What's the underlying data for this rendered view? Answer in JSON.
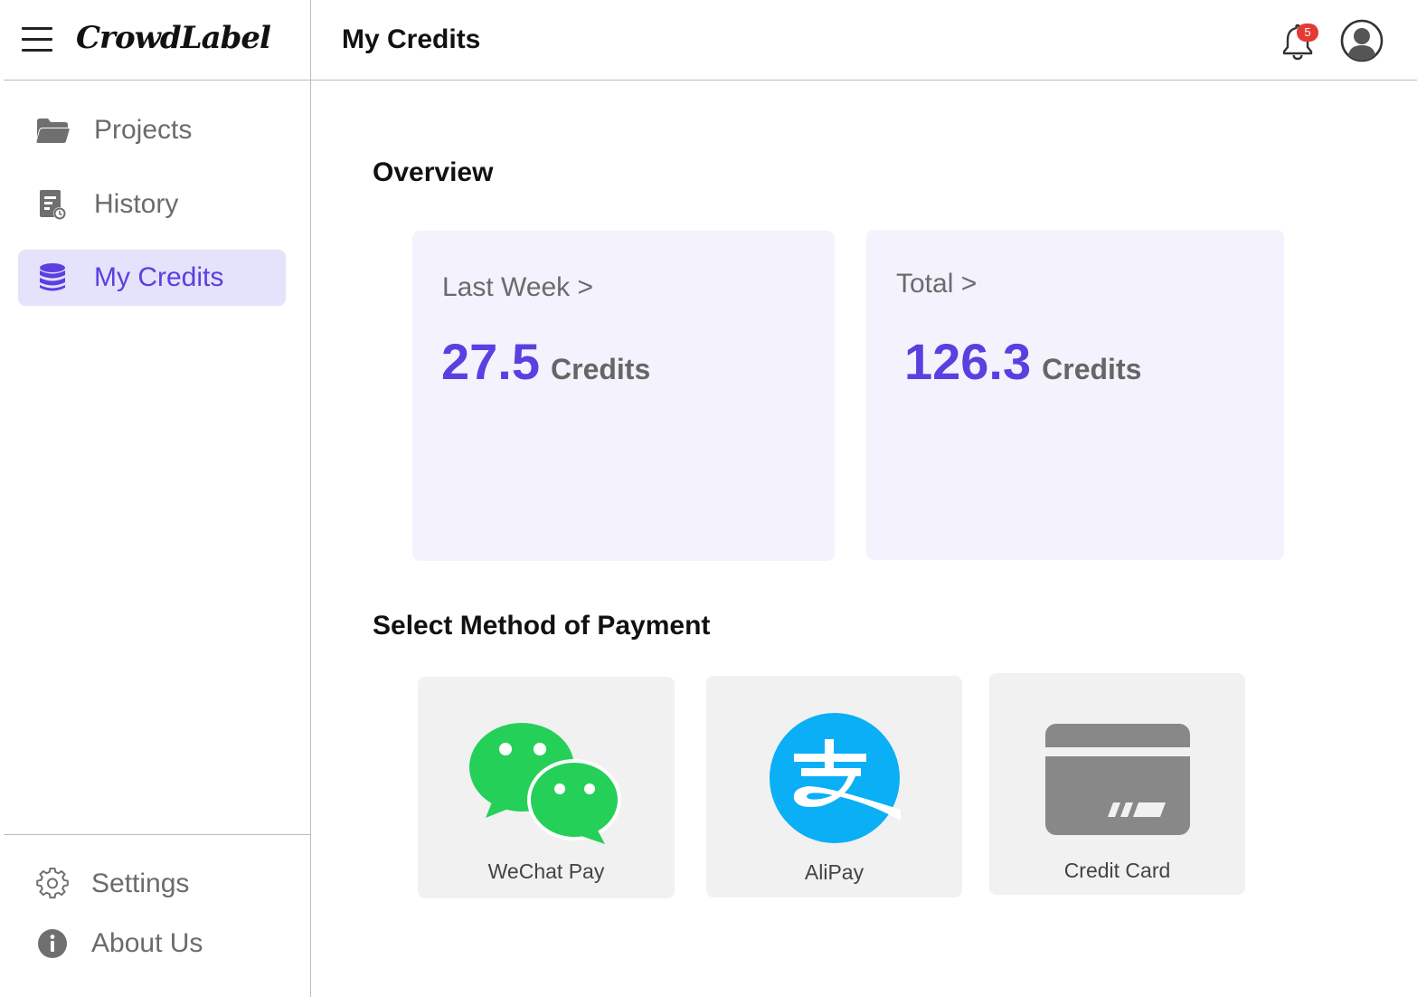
{
  "app": {
    "name": "CrowdLabel"
  },
  "sidebar": {
    "items": [
      {
        "label": "Projects",
        "icon": "folder-icon"
      },
      {
        "label": "History",
        "icon": "history-document-icon"
      },
      {
        "label": "My Credits",
        "icon": "database-icon",
        "active": true
      }
    ],
    "bottom_items": [
      {
        "label": "Settings",
        "icon": "gear-icon"
      },
      {
        "label": "About Us",
        "icon": "info-icon"
      }
    ]
  },
  "header": {
    "title": "My Credits",
    "notification_count": "5"
  },
  "overview": {
    "title": "Overview",
    "cards": [
      {
        "heading": "Last Week >",
        "value": "27.5",
        "unit": "Credits"
      },
      {
        "heading": "Total >",
        "value": "126.3",
        "unit": "Credits"
      }
    ]
  },
  "payment": {
    "title": "Select Method of Payment",
    "methods": [
      {
        "label": "WeChat Pay",
        "icon": "wechat-icon"
      },
      {
        "label": "AliPay",
        "icon": "alipay-icon"
      },
      {
        "label": "Credit Card",
        "icon": "credit-card-icon"
      }
    ]
  },
  "colors": {
    "accent": "#5b3fe0",
    "active_bg": "#e5e2fb",
    "card_bg": "#f3f2fd",
    "wechat": "#2dc100",
    "alipay": "#1aaaf0",
    "badge": "#e53935"
  }
}
